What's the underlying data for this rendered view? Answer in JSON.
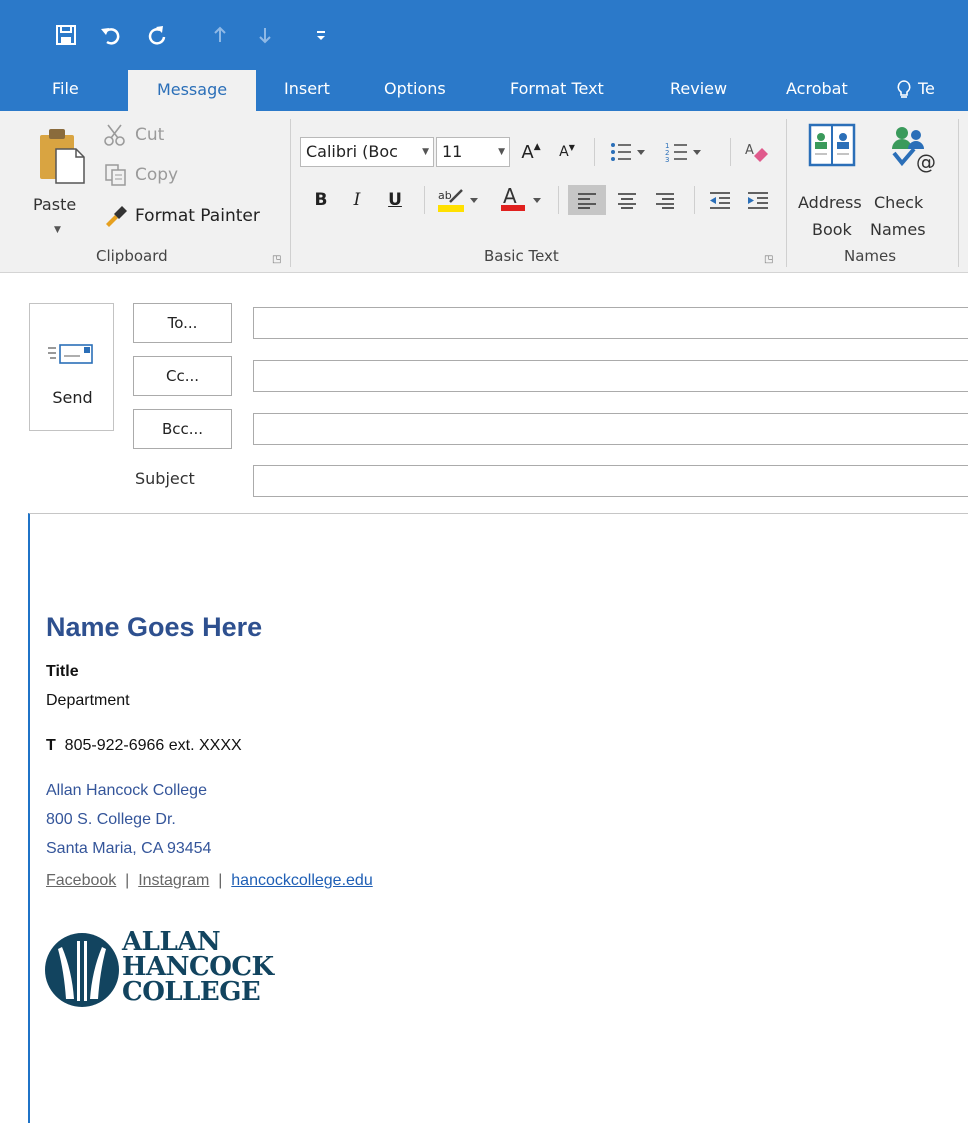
{
  "quick_access": {
    "icons": [
      "save-icon",
      "undo-icon",
      "redo-icon",
      "up-arrow-icon",
      "down-arrow-icon",
      "customize-icon"
    ]
  },
  "tabs": [
    {
      "label": "File"
    },
    {
      "label": "Message"
    },
    {
      "label": "Insert"
    },
    {
      "label": "Options"
    },
    {
      "label": "Format Text"
    },
    {
      "label": "Review"
    },
    {
      "label": "Acrobat"
    },
    {
      "label": "Te"
    }
  ],
  "active_tab": "Message",
  "ribbon": {
    "clipboard": {
      "paste": "Paste",
      "cut": "Cut",
      "copy": "Copy",
      "format_painter": "Format Painter",
      "group_label": "Clipboard"
    },
    "basic_text": {
      "font_name": "Calibri (Boc",
      "font_size": "11",
      "bold": "B",
      "italic": "I",
      "underline": "U",
      "grow_font": "A",
      "shrink_font": "A",
      "highlight_color": "#ffe000",
      "font_color": "#e0201e",
      "group_label": "Basic Text"
    },
    "names": {
      "address_book_1": "Address",
      "address_book_2": "Book",
      "check_names_1": "Check",
      "check_names_2": "Names",
      "group_label": "Names"
    }
  },
  "header": {
    "send": "Send",
    "to": "To...",
    "cc": "Cc...",
    "bcc": "Bcc...",
    "subject": "Subject",
    "to_value": "",
    "cc_value": "",
    "bcc_value": "",
    "subject_value": ""
  },
  "signature": {
    "name": "Name Goes Here",
    "title": "Title",
    "department": "Department",
    "phone_prefix": "T",
    "phone": "805-922-6966 ext. XXXX",
    "college": "Allan Hancock College",
    "address1": "800 S. College Dr.",
    "address2": "Santa Maria, CA 93454",
    "link_facebook": "Facebook",
    "link_instagram": "Instagram",
    "link_site": "hancockcollege.edu",
    "separator": "|",
    "logo_line1": "ALLAN",
    "logo_line2": "HANCOCK",
    "logo_line3": "COLLEGE"
  },
  "colors": {
    "accent": "#2b79c9",
    "name_blue": "#2e508f",
    "link_blue": "#1f5fb5",
    "logo_navy": "#12445f"
  }
}
